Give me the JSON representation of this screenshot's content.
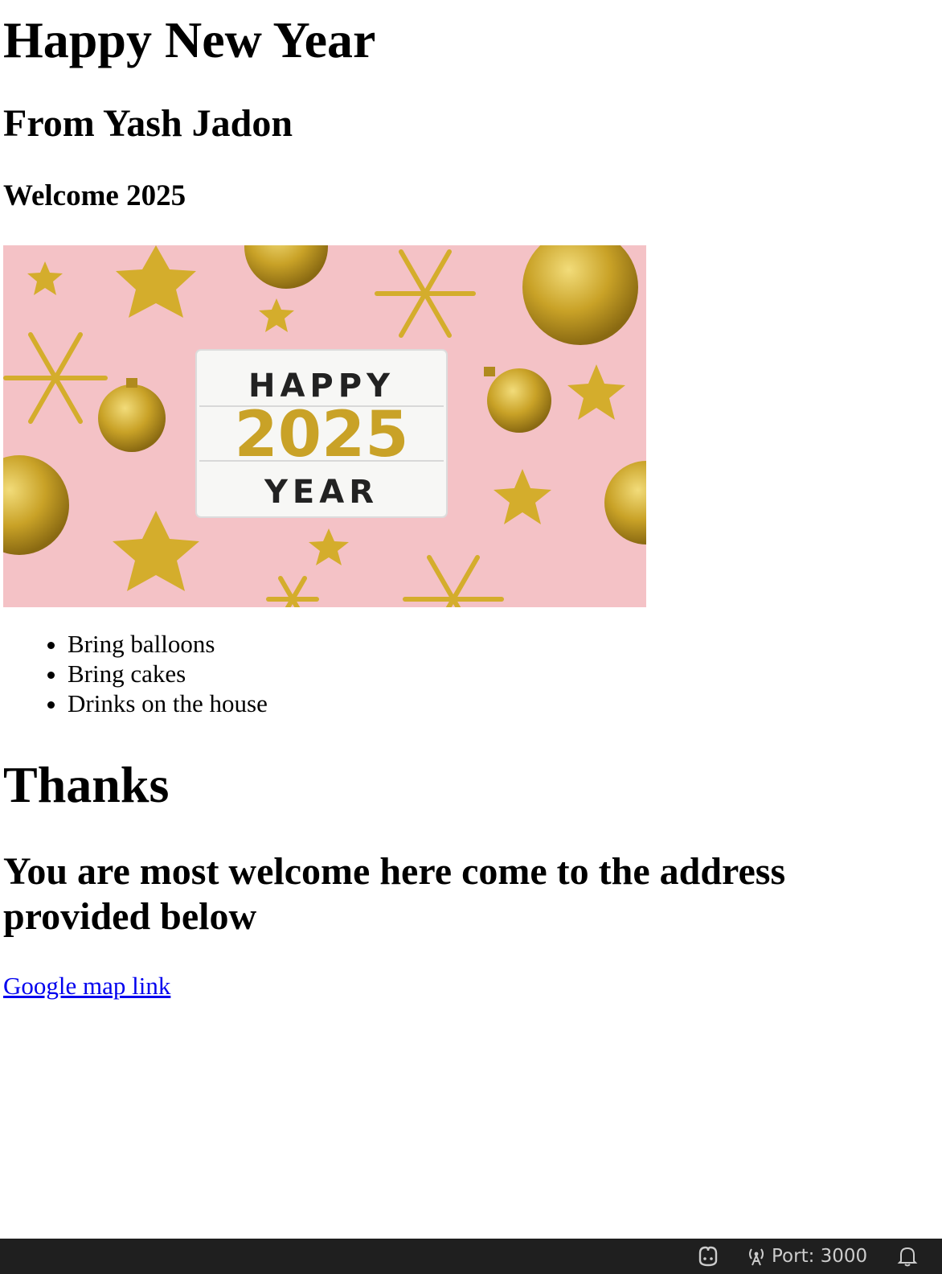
{
  "page": {
    "title": "Happy New Year",
    "subtitle": "From Yash Jadon",
    "welcome": "Welcome 2025",
    "hero_image": {
      "sign_line1": "HAPPY",
      "sign_line2": "2025",
      "sign_line3": "YEAR",
      "background_color": "#f4c2c6",
      "accent_color": "#c9a227"
    },
    "list_items": [
      "Bring balloons",
      "Bring cakes",
      "Drinks on the house"
    ],
    "thanks": "Thanks",
    "address_note": "You are most welcome here come to the address provided below",
    "map_link_text": "Google map link",
    "link_color": "#0000ee"
  },
  "statusbar": {
    "copilot_icon": "copilot-icon",
    "port_icon": "broadcast-antenna-icon",
    "port_label": "Port: 3000",
    "notification_icon": "bell-icon",
    "background": "#1f1f1f"
  }
}
